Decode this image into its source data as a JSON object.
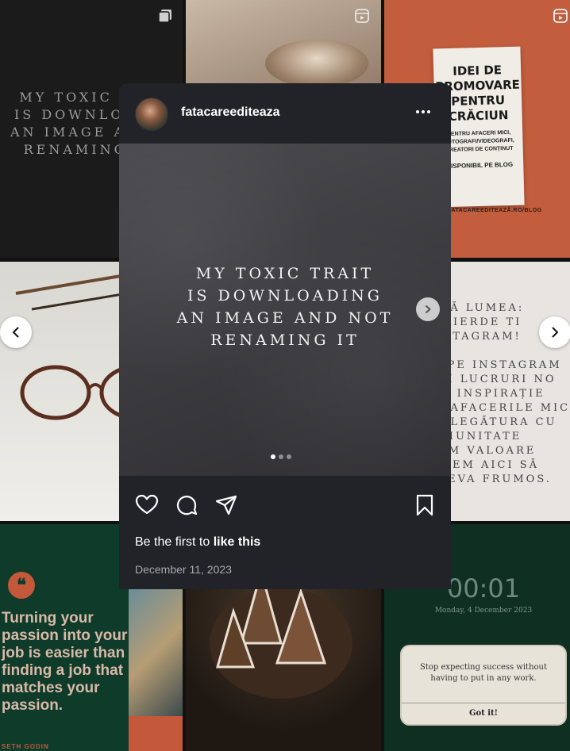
{
  "background_grid": {
    "tile1_quote": "MY TOXIC T\nIS DOWNLOA\nAN IMAGE AN\nRENAMING",
    "tile3": {
      "title": "IDEI DE\nPROMOVARE\nPENTRU\nCRĂCIUN",
      "subtitle": "PENTRU AFACERI MICI,\nFOTOGRAFI/VIDEOGRAFI,\nCREATORI DE CONȚINUT",
      "cta": "DISPONIBIL PE BLOG",
      "url": "FATACAREEDITEAZĂ.RO/BLOG"
    },
    "tile6_quote": "ATĂ LUMEA:\nI PIERDE TI\nNSTAGRAM!\n\nE PE INSTAGRAM\nĂM LUCRURI NO\nIM INSPIRAȚIE\nM AFACERILE MIC\nM LEGĂTURA CU\nOMUNITATE\nRIM VALOARE\nNTEM AICI SĂ\n CEVA FRUMOS.",
    "tile7": {
      "quote": "Turning your passion into your job is easier than finding a job that matches your passion.",
      "author": "SETH GODIN"
    },
    "tile9": {
      "time": "00:01",
      "date": "Monday, 4 December 2023",
      "message": "Stop expecting success without having to put in any work.",
      "button": "Got it!"
    }
  },
  "modal": {
    "username": "fatacareediteaza",
    "post_text": "MY TOXIC TRAIT\nIS DOWNLOADING\nAN IMAGE AND NOT\nRENAMING IT",
    "carousel": {
      "count": 3,
      "active_index": 1
    },
    "likes": {
      "prefix": "Be the first to ",
      "action": "like this"
    },
    "date": "December 11, 2023"
  },
  "colors": {
    "modal_bg": "#212329",
    "terracotta": "#c4583b",
    "forest": "#0f3b2a"
  }
}
